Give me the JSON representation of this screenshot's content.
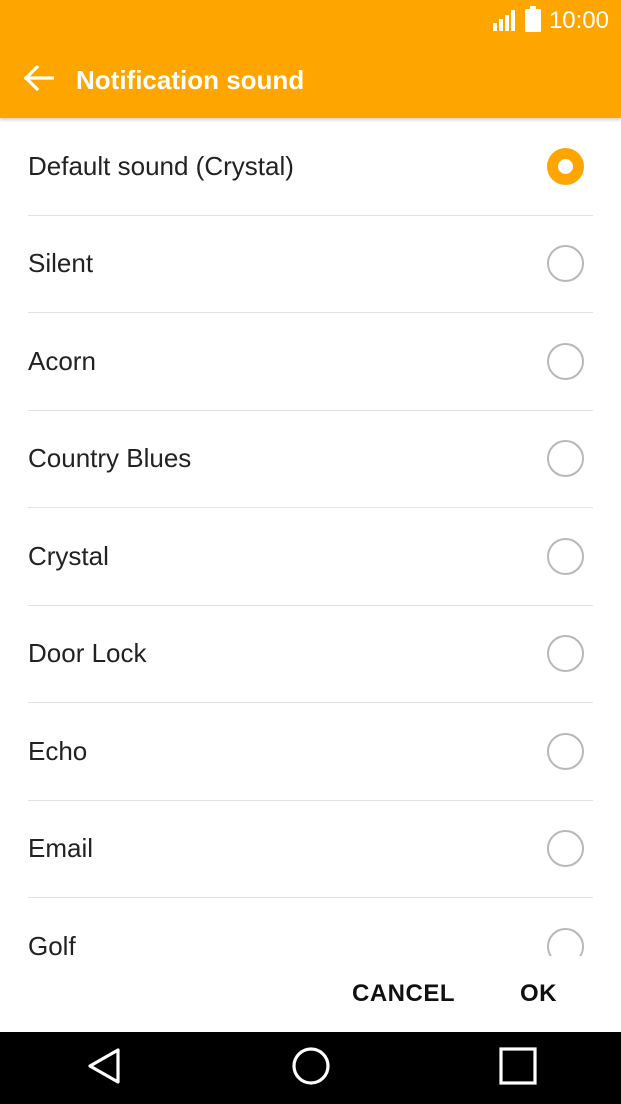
{
  "status_bar": {
    "time": "10:00",
    "signal_icon": "signal-icon",
    "battery_icon": "battery-icon"
  },
  "toolbar": {
    "title": "Notification sound",
    "back_icon": "arrow-left-icon"
  },
  "accent_color": "#FFA500",
  "sounds": [
    {
      "label": "Default sound (Crystal)",
      "selected": true
    },
    {
      "label": "Silent",
      "selected": false
    },
    {
      "label": "Acorn",
      "selected": false
    },
    {
      "label": "Country Blues",
      "selected": false
    },
    {
      "label": "Crystal",
      "selected": false
    },
    {
      "label": "Door Lock",
      "selected": false
    },
    {
      "label": "Echo",
      "selected": false
    },
    {
      "label": "Email",
      "selected": false
    },
    {
      "label": "Golf",
      "selected": false
    }
  ],
  "actions": {
    "cancel_label": "CANCEL",
    "ok_label": "OK"
  },
  "nav": {
    "back_icon": "back-triangle-icon",
    "home_icon": "home-circle-icon",
    "recents_icon": "recents-square-icon"
  }
}
